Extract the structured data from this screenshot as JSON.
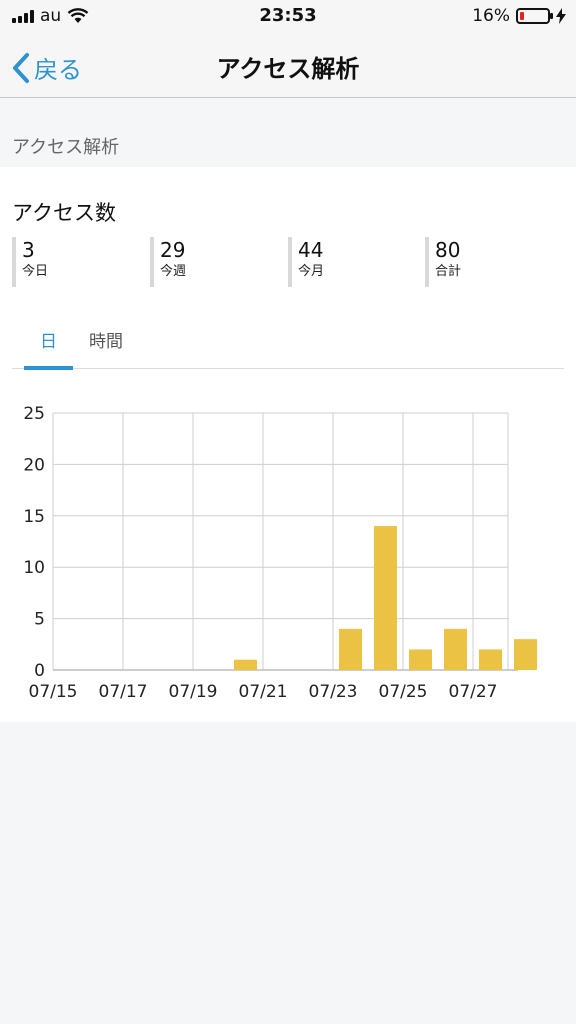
{
  "status_bar": {
    "carrier": "au",
    "time": "23:53",
    "battery_percent": "16%",
    "battery_level": 0.16
  },
  "nav": {
    "back_label": "戻る",
    "title": "アクセス解析"
  },
  "section_header": "アクセス解析",
  "card": {
    "title": "アクセス数",
    "stats": [
      {
        "value": "3",
        "label": "今日"
      },
      {
        "value": "29",
        "label": "今週"
      },
      {
        "value": "44",
        "label": "今月"
      },
      {
        "value": "80",
        "label": "合計"
      }
    ],
    "tabs": [
      {
        "label": "日",
        "active": true
      },
      {
        "label": "時間",
        "active": false
      }
    ]
  },
  "colors": {
    "accent": "#2e93d1",
    "bar": "#ecc244",
    "battery_low": "#e02525"
  },
  "chart_data": {
    "type": "bar",
    "x": [
      "07/15",
      "07/16",
      "07/17",
      "07/18",
      "07/19",
      "07/20",
      "07/21",
      "07/22",
      "07/23",
      "07/24",
      "07/25",
      "07/26",
      "07/27",
      "07/28"
    ],
    "values": [
      0,
      0,
      0,
      0,
      0,
      1,
      0,
      0,
      4,
      14,
      2,
      4,
      2,
      3
    ],
    "x_tick_labels": [
      "07/15",
      "07/17",
      "07/19",
      "07/21",
      "07/23",
      "07/25",
      "07/27"
    ],
    "y_ticks": [
      0,
      5,
      10,
      15,
      20,
      25
    ],
    "ylim": [
      0,
      25
    ],
    "grid": true
  }
}
